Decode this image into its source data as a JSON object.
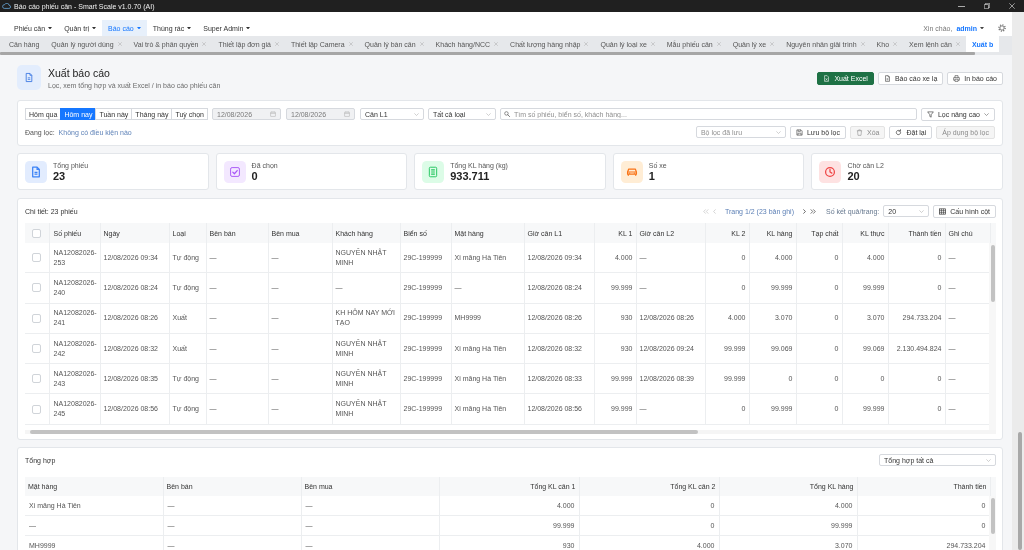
{
  "window": {
    "title": "Báo cáo phiếu cân - Smart Scale v1.0.70 (AI)"
  },
  "menu": {
    "items": [
      {
        "label": "Phiếu cân",
        "selected": false
      },
      {
        "label": "Quản trị",
        "selected": false
      },
      {
        "label": "Báo cáo",
        "selected": true
      },
      {
        "label": "Thùng rác",
        "selected": false
      },
      {
        "label": "Super Admin",
        "selected": false
      }
    ],
    "greeting": "Xin chào,",
    "user": "admin"
  },
  "tabs": [
    {
      "label": "Cân hàng",
      "closable": false,
      "selected": false
    },
    {
      "label": "Quản lý người dùng",
      "closable": true,
      "selected": false
    },
    {
      "label": "Vai trò & phân quyền",
      "closable": true,
      "selected": false
    },
    {
      "label": "Thiết lập đơn giá",
      "closable": true,
      "selected": false
    },
    {
      "label": "Thiết lập Camera",
      "closable": true,
      "selected": false
    },
    {
      "label": "Quản lý bàn cân",
      "closable": true,
      "selected": false
    },
    {
      "label": "Khách hàng/NCC",
      "closable": true,
      "selected": false
    },
    {
      "label": "Chất lượng hàng nhập",
      "closable": true,
      "selected": false
    },
    {
      "label": "Quản lý loại xe",
      "closable": true,
      "selected": false
    },
    {
      "label": "Mẫu phiếu cân",
      "closable": true,
      "selected": false
    },
    {
      "label": "Quản lý xe",
      "closable": true,
      "selected": false
    },
    {
      "label": "Nguyên nhân giải trình",
      "closable": true,
      "selected": false
    },
    {
      "label": "Kho",
      "closable": true,
      "selected": false
    },
    {
      "label": "Xem lệnh cân",
      "closable": true,
      "selected": false
    },
    {
      "label": "Xuất b",
      "closable": false,
      "selected": true
    }
  ],
  "header": {
    "title": "Xuất báo cáo",
    "subtitle": "Lọc, xem tổng hợp và xuất Excel / in báo cáo phiếu cân",
    "actions": [
      {
        "label": "Xuất Excel",
        "kind": "excel"
      },
      {
        "label": "Báo cáo xe lạ",
        "kind": "doc"
      },
      {
        "label": "In báo cáo",
        "kind": "print"
      }
    ]
  },
  "filters": {
    "ranges": [
      {
        "label": "Hôm qua",
        "selected": false
      },
      {
        "label": "Hôm nay",
        "selected": true
      },
      {
        "label": "Tuần này",
        "selected": false
      },
      {
        "label": "Tháng này",
        "selected": false
      },
      {
        "label": "Tuỳ chọn",
        "selected": false
      }
    ],
    "date_from": {
      "value": "12/08/2026",
      "disabled": true
    },
    "date_to": {
      "value": "12/08/2026",
      "disabled": true
    },
    "scale": "Cân L1",
    "type": "Tất cả loại",
    "search": {
      "placeholder": "Tìm số phiếu, biển số, khách hàng..."
    },
    "advanced": "Lọc nâng cao",
    "active_label": "Đang lọc:",
    "active_value": "Không có điều kiện nào",
    "saved_filter": {
      "placeholder": "Bộ lọc đã lưu"
    },
    "buttons": [
      {
        "label": "Lưu bộ lọc",
        "kind": "save",
        "disabled": false
      },
      {
        "label": "Xóa",
        "kind": "delete",
        "disabled": true
      },
      {
        "label": "Đặt lại",
        "kind": "reset",
        "disabled": false
      },
      {
        "label": "Áp dụng bộ lọc",
        "kind": "apply",
        "disabled": true
      }
    ]
  },
  "stats": [
    {
      "label": "Tổng phiếu",
      "value": "23",
      "kind": "tickets"
    },
    {
      "label": "Đã chọn",
      "value": "0",
      "kind": "selected"
    },
    {
      "label": "Tổng KL hàng (kg)",
      "value": "933.711",
      "kind": "weight"
    },
    {
      "label": "Số xe",
      "value": "1",
      "kind": "vehicles"
    },
    {
      "label": "Chờ cân L2",
      "value": "20",
      "kind": "pending"
    }
  ],
  "detail": {
    "title": "Chi tiết: 23 phiếu",
    "pager": {
      "first": {
        "disabled": true
      },
      "prev": {
        "disabled": true
      },
      "info": "Trang 1/2 (23 bản ghi)",
      "next": {
        "disabled": false
      },
      "last": {
        "disabled": false
      },
      "size_label": "Số kết quả/trang:",
      "size": "20"
    },
    "columns_button": "Cấu hình cột",
    "all_checked": false,
    "columns": [
      "Số phiếu",
      "Ngày",
      "Loại",
      "Bên bán",
      "Bên mua",
      "Khách hàng",
      "Biển số",
      "Mặt hàng",
      "Giờ cân L1",
      "KL 1",
      "Giờ cân L2",
      "KL 2",
      "KL hàng",
      "Tạp chất",
      "KL thực",
      "Thành tiền",
      "Ghi chú"
    ],
    "rows": [
      {
        "checked": false,
        "cells": [
          "NA12082026-253",
          "12/08/2026 09:34",
          "Tự động",
          "—",
          "—",
          "NGUYỄN NHẬT MINH",
          "29C-199999",
          "Xi măng Hà Tiên",
          "12/08/2026 09:34",
          "4.000",
          "—",
          "0",
          "4.000",
          "0",
          "4.000",
          "0",
          "—"
        ]
      },
      {
        "checked": false,
        "cells": [
          "NA12082026-240",
          "12/08/2026 08:24",
          "Tự động",
          "—",
          "—",
          "—",
          "29C-199999",
          "—",
          "12/08/2026 08:24",
          "99.999",
          "—",
          "0",
          "99.999",
          "0",
          "99.999",
          "0",
          "—"
        ]
      },
      {
        "checked": false,
        "cells": [
          "NA12082026-241",
          "12/08/2026 08:26",
          "Xuất",
          "—",
          "—",
          "KH HÔM NAY MỚI TẠO",
          "29C-199999",
          "MH9999",
          "12/08/2026 08:26",
          "930",
          "12/08/2026 08:26",
          "4.000",
          "3.070",
          "0",
          "3.070",
          "294.733.204",
          "—"
        ]
      },
      {
        "checked": false,
        "cells": [
          "NA12082026-242",
          "12/08/2026 08:32",
          "Xuất",
          "—",
          "—",
          "NGUYỄN NHẬT MINH",
          "29C-199999",
          "Xi măng Hà Tiên",
          "12/08/2026 08:32",
          "930",
          "12/08/2026 09:24",
          "99.999",
          "99.069",
          "0",
          "99.069",
          "2.130.494.824",
          "—"
        ]
      },
      {
        "checked": false,
        "cells": [
          "NA12082026-243",
          "12/08/2026 08:35",
          "Tự động",
          "—",
          "—",
          "NGUYỄN NHẬT MINH",
          "29C-199999",
          "Xi măng Hà Tiên",
          "12/08/2026 08:33",
          "99.999",
          "12/08/2026 08:39",
          "99.999",
          "0",
          "0",
          "0",
          "0",
          "—"
        ]
      },
      {
        "checked": false,
        "cells": [
          "NA12082026-245",
          "12/08/2026 08:56",
          "Tự động",
          "—",
          "—",
          "NGUYỄN NHẬT MINH",
          "29C-199999",
          "Xi măng Hà Tiên",
          "12/08/2026 08:56",
          "99.999",
          "—",
          "0",
          "99.999",
          "0",
          "99.999",
          "0",
          "—"
        ]
      }
    ]
  },
  "summary": {
    "title": "Tổng hợp",
    "group": "Tổng hợp tất cả",
    "columns": [
      "Mặt hàng",
      "Bên bán",
      "Bên mua",
      "Tổng KL cân 1",
      "Tổng KL cân 2",
      "Tổng KL hàng",
      "Thành tiền"
    ],
    "rows": [
      [
        "Xi măng Hà Tiên",
        "—",
        "—",
        "4.000",
        "0",
        "4.000",
        "0"
      ],
      [
        "—",
        "—",
        "—",
        "99.999",
        "0",
        "99.999",
        "0"
      ],
      [
        "MH9999",
        "—",
        "—",
        "930",
        "4.000",
        "3.070",
        "294.733.204"
      ]
    ]
  }
}
